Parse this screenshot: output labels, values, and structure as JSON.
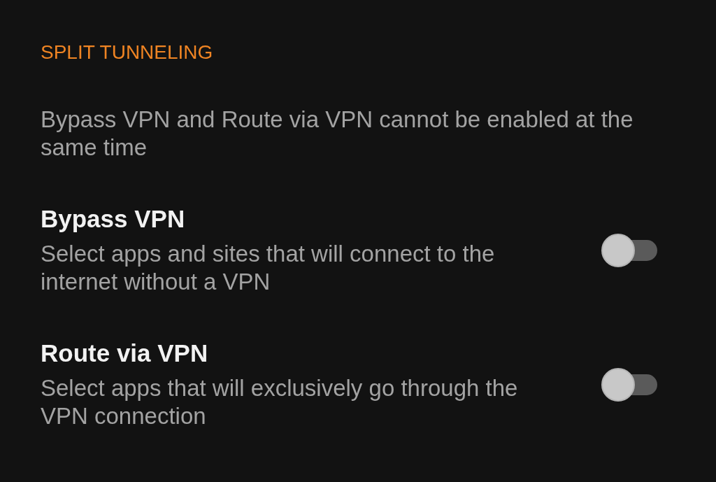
{
  "section_header": "SPLIT TUNNELING",
  "note": "Bypass VPN and Route via VPN cannot be enabled at the same time",
  "settings": [
    {
      "title": "Bypass VPN",
      "description": "Select apps and sites that will connect to the internet without a VPN",
      "on": false
    },
    {
      "title": "Route via VPN",
      "description": "Select apps that will exclusively go through the VPN connection",
      "on": false
    }
  ]
}
